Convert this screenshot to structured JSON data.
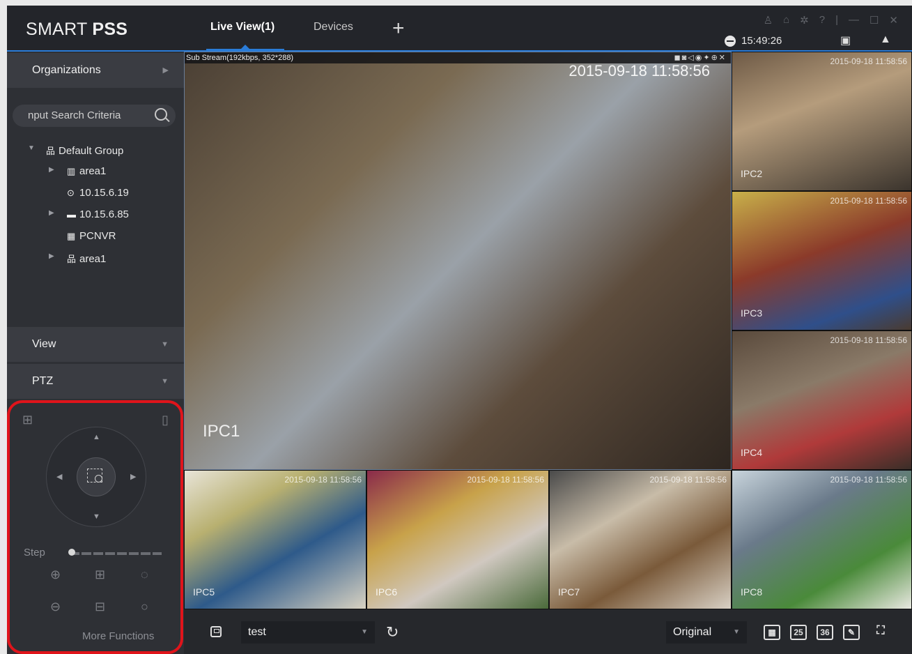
{
  "app": {
    "brand_light": "SMART ",
    "brand_bold": "PSS",
    "tabs": [
      {
        "label": "Live View(1)",
        "active": true
      },
      {
        "label": "Devices",
        "active": false
      }
    ],
    "add_tab_glyph": "+",
    "clock": "15:49:26"
  },
  "sidebar": {
    "organizations_label": "Organizations",
    "search_placeholder": "nput Search Criteria",
    "tree": [
      {
        "label": "Default Group",
        "icon": "org-icon",
        "level": 0,
        "expanded": true
      },
      {
        "label": "area1",
        "icon": "map-icon",
        "level": 1,
        "expandable": true
      },
      {
        "label": "10.15.6.19",
        "icon": "camera-icon",
        "level": 1,
        "expandable": false
      },
      {
        "label": "10.15.6.85",
        "icon": "nvr-icon",
        "level": 1,
        "expandable": true
      },
      {
        "label": "PCNVR",
        "icon": "pcnvr-icon",
        "level": 1,
        "expandable": false
      },
      {
        "label": "area1",
        "icon": "org-icon",
        "level": 1,
        "expandable": true
      }
    ],
    "view_label": "View",
    "ptz_label": "PTZ",
    "step_label": "Step",
    "step_value": 0,
    "more_functions_label": "More Functions"
  },
  "video": {
    "stream_info": "Sub Stream(192kbps, 352*288)",
    "tiles": [
      {
        "id": "IPC1",
        "timestamp": "2015-09-18 11:58:56",
        "cam_label": "IPC1"
      },
      {
        "id": "IPC2",
        "timestamp": "2015-09-18 11:58:56",
        "cam_label": "IPC2"
      },
      {
        "id": "IPC3",
        "timestamp": "2015-09-18 11:58:56",
        "cam_label": "IPC3"
      },
      {
        "id": "IPC4",
        "timestamp": "2015-09-18 11:58:56",
        "cam_label": "IPC4"
      },
      {
        "id": "IPC5",
        "timestamp": "2015-09-18 11:58:56",
        "cam_label": "IPC5"
      },
      {
        "id": "IPC6",
        "timestamp": "2015-09-18 11:58:56",
        "cam_label": "IPC6"
      },
      {
        "id": "IPC7",
        "timestamp": "2015-09-18 11:58:56",
        "cam_label": "IPC7"
      },
      {
        "id": "IPC8",
        "timestamp": "2015-09-18 11:58:56",
        "cam_label": "IPC8"
      }
    ]
  },
  "bottombar": {
    "view_name": "test",
    "stream_quality": "Original",
    "layout_25": "25",
    "layout_36": "36"
  },
  "colors": {
    "accent": "#2a7cd8",
    "highlight": "#e0141b"
  }
}
